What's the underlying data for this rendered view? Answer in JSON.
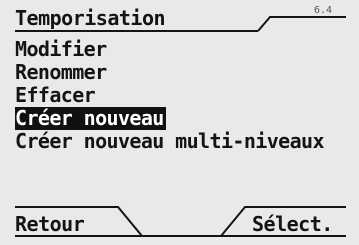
{
  "header": {
    "title": "Temporisation",
    "page_indicator": "6.4"
  },
  "menu": {
    "items": [
      {
        "label": "Modifier",
        "selected": false
      },
      {
        "label": "Renommer",
        "selected": false
      },
      {
        "label": "Effacer",
        "selected": false
      },
      {
        "label": "Créer nouveau",
        "selected": true
      },
      {
        "label": "Créer nouveau multi-niveaux",
        "selected": false
      }
    ]
  },
  "softkeys": {
    "left_label": "Retour",
    "right_label": "Sélect."
  },
  "colors": {
    "background": "#e9e9e9",
    "foreground": "#141414",
    "highlight": "#111111"
  }
}
